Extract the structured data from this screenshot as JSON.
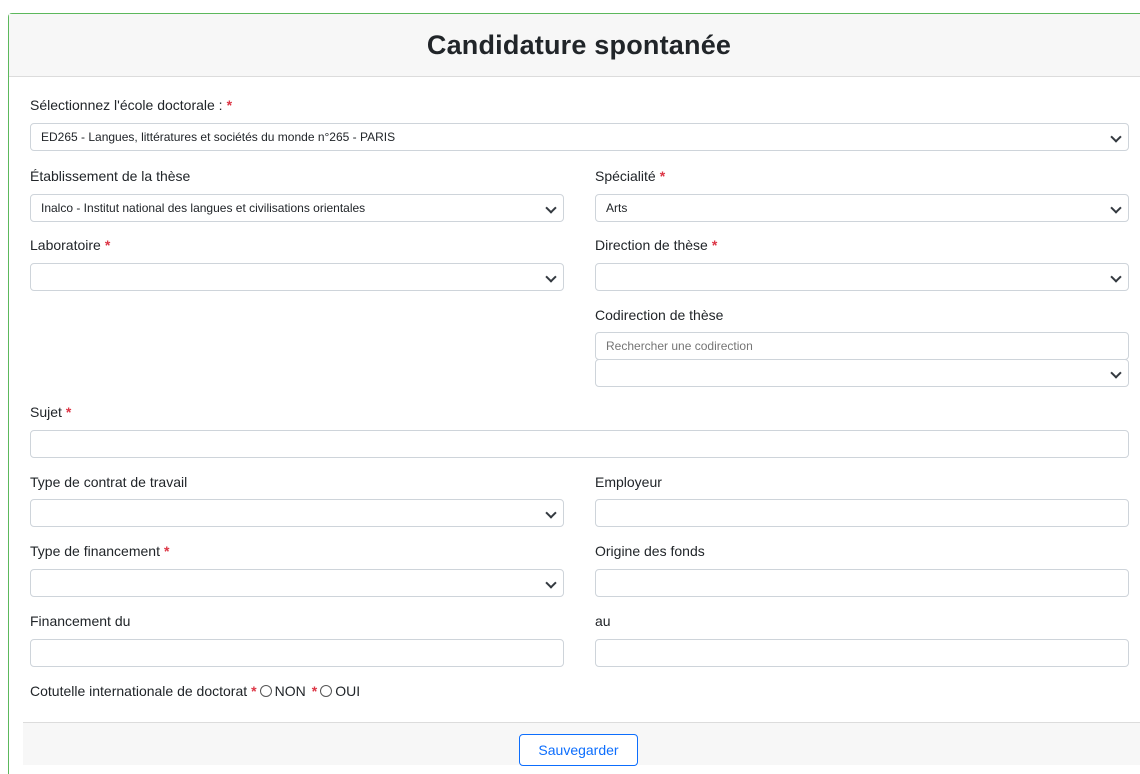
{
  "title": "Candidature spontanée",
  "required_mark": "*",
  "ecole": {
    "label": "Sélectionnez l'école doctorale :",
    "value": "ED265 - Langues, littératures et sociétés du monde n°265 - PARIS"
  },
  "etablissement": {
    "label": "Établissement de la thèse",
    "value": "Inalco - Institut national des langues et civilisations orientales"
  },
  "specialite": {
    "label": "Spécialité",
    "value": "Arts"
  },
  "laboratoire": {
    "label": "Laboratoire",
    "value": ""
  },
  "direction": {
    "label": "Direction de thèse",
    "value": ""
  },
  "codirection": {
    "label": "Codirection de thèse",
    "search_placeholder": "Rechercher une codirection",
    "value": ""
  },
  "sujet": {
    "label": "Sujet",
    "value": ""
  },
  "contrat": {
    "label": "Type de contrat de travail",
    "value": ""
  },
  "employeur": {
    "label": "Employeur",
    "value": ""
  },
  "financement": {
    "label": "Type de financement",
    "value": ""
  },
  "origine": {
    "label": "Origine des fonds",
    "value": ""
  },
  "financement_du": {
    "label": "Financement du",
    "value": ""
  },
  "au": {
    "label": "au",
    "value": ""
  },
  "cotutelle": {
    "label": "Cotutelle internationale de doctorat",
    "option_non": "NON",
    "option_oui": "OUI"
  },
  "save_label": "Sauvegarder",
  "colors": {
    "required": "#dc3545",
    "card_border": "#5cb85c",
    "button": "#0d6efd",
    "header_bg": "#f7f7f7"
  }
}
